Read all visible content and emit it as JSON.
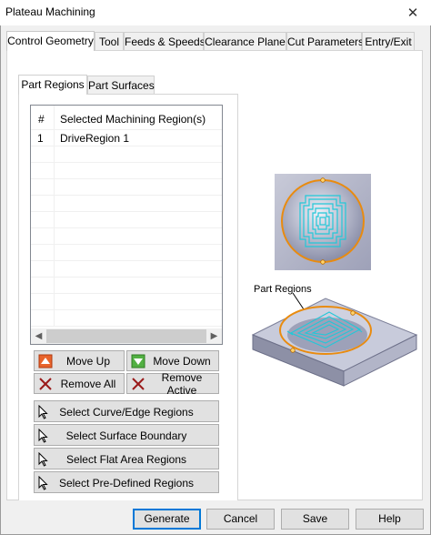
{
  "window": {
    "title": "Plateau Machining",
    "close_glyph": "✕"
  },
  "tabs": [
    {
      "label": "Control Geometry",
      "active": true
    },
    {
      "label": "Tool"
    },
    {
      "label": "Feeds & Speeds"
    },
    {
      "label": "Clearance Plane"
    },
    {
      "label": "Cut Parameters"
    },
    {
      "label": "Entry/Exit"
    }
  ],
  "subtabs": [
    {
      "label": "Part Regions",
      "active": true
    },
    {
      "label": "Part Surfaces"
    }
  ],
  "list": {
    "headers": [
      "#",
      "Selected Machining Region(s)"
    ],
    "rows": [
      {
        "num": "1",
        "name": "DriveRegion 1"
      }
    ]
  },
  "actions": {
    "move_up": "Move Up",
    "move_down": "Move Down",
    "remove_all": "Remove All",
    "remove_active": "Remove Active"
  },
  "select_buttons": [
    "Select Curve/Edge Regions",
    "Select Surface Boundary",
    "Select Flat Area Regions",
    "Select Pre-Defined Regions"
  ],
  "illustration": {
    "label": "Part Regions"
  },
  "footer": {
    "generate": "Generate",
    "cancel": "Cancel",
    "save": "Save",
    "help": "Help"
  },
  "colors": {
    "accent_orange": "#e98b0f",
    "toolpath_cyan": "#22c8d8",
    "arrow_up_bg": "#e8632b",
    "arrow_down_bg": "#52b043",
    "remove_x": "#9a1a1a"
  }
}
